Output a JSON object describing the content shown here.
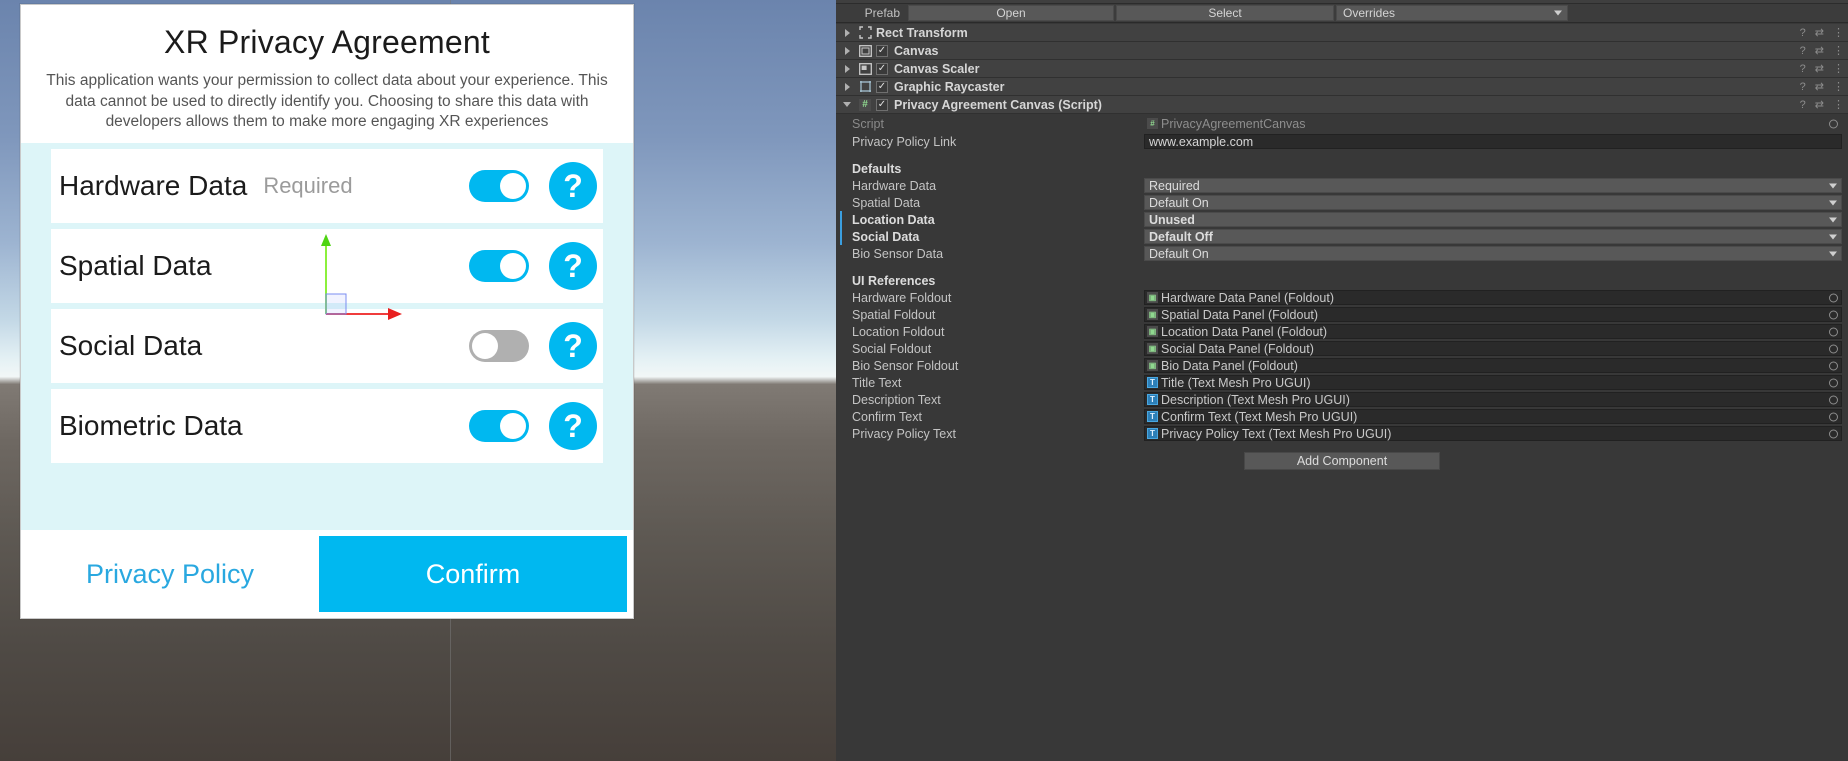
{
  "scene": {
    "xr_panel": {
      "title": "XR Privacy Agreement",
      "description": "This application wants your permission to collect data about your experience. This data cannot be used to directly identify you. Choosing to share this data with developers allows them to make more engaging XR experiences",
      "rows": [
        {
          "label": "Hardware Data",
          "note": "Required",
          "toggle": "on",
          "help": "?"
        },
        {
          "label": "Spatial Data",
          "note": "",
          "toggle": "on",
          "help": "?"
        },
        {
          "label": "Social Data",
          "note": "",
          "toggle": "off",
          "help": "?"
        },
        {
          "label": "Biometric Data",
          "note": "",
          "toggle": "on",
          "help": "?"
        }
      ],
      "privacy_policy_label": "Privacy Policy",
      "confirm_label": "Confirm",
      "accent_color": "#00b8f0",
      "link_color": "#29a8e0",
      "body_bg": "#ddf5f8"
    }
  },
  "inspector": {
    "prefab": {
      "label": "Prefab",
      "open_label": "Open",
      "select_label": "Select",
      "overrides_label": "Overrides"
    },
    "components": [
      {
        "name": "Rect Transform",
        "expanded": false,
        "has_checkbox": false,
        "checked": false,
        "icon": "rect-transform-icon"
      },
      {
        "name": "Canvas",
        "expanded": false,
        "has_checkbox": true,
        "checked": true,
        "icon": "canvas-icon"
      },
      {
        "name": "Canvas Scaler",
        "expanded": false,
        "has_checkbox": true,
        "checked": true,
        "icon": "canvas-scaler-icon"
      },
      {
        "name": "Graphic Raycaster",
        "expanded": false,
        "has_checkbox": true,
        "checked": true,
        "icon": "graphic-raycaster-icon"
      },
      {
        "name": "Privacy Agreement Canvas (Script)",
        "expanded": true,
        "has_checkbox": true,
        "checked": true,
        "icon": "script-icon"
      }
    ],
    "script_row": {
      "label": "Script",
      "value": "PrivacyAgreementCanvas"
    },
    "privacy_policy_link": {
      "label": "Privacy Policy Link",
      "value": "www.example.com"
    },
    "defaults_header": "Defaults",
    "defaults": [
      {
        "label": "Hardware Data",
        "value": "Required",
        "modified": false
      },
      {
        "label": "Spatial Data",
        "value": "Default On",
        "modified": false
      },
      {
        "label": "Location Data",
        "value": "Unused",
        "modified": true
      },
      {
        "label": "Social Data",
        "value": "Default Off",
        "modified": true
      },
      {
        "label": "Bio Sensor Data",
        "value": "Default On",
        "modified": false
      }
    ],
    "ui_references_header": "UI References",
    "ui_references": [
      {
        "label": "Hardware Foldout",
        "value": "Hardware Data Panel (Foldout)",
        "icon": "prefab-icon"
      },
      {
        "label": "Spatial Foldout",
        "value": "Spatial Data Panel (Foldout)",
        "icon": "prefab-icon"
      },
      {
        "label": "Location Foldout",
        "value": "Location Data Panel (Foldout)",
        "icon": "prefab-icon"
      },
      {
        "label": "Social Foldout",
        "value": "Social Data Panel (Foldout)",
        "icon": "prefab-icon"
      },
      {
        "label": "Bio Sensor Foldout",
        "value": "Bio Data Panel (Foldout)",
        "icon": "prefab-icon"
      },
      {
        "label": "Title Text",
        "value": "Title (Text Mesh Pro UGUI)",
        "icon": "textmeshpro-icon"
      },
      {
        "label": "Description Text",
        "value": "Description (Text Mesh Pro UGUI)",
        "icon": "textmeshpro-icon"
      },
      {
        "label": "Confirm Text",
        "value": "Confirm Text (Text Mesh Pro UGUI)",
        "icon": "textmeshpro-icon"
      },
      {
        "label": "Privacy Policy Text",
        "value": "Privacy Policy Text (Text Mesh Pro UGUI)",
        "icon": "textmeshpro-icon"
      }
    ],
    "add_component_label": "Add Component",
    "modified_indicator_color": "#3b9fe0"
  }
}
